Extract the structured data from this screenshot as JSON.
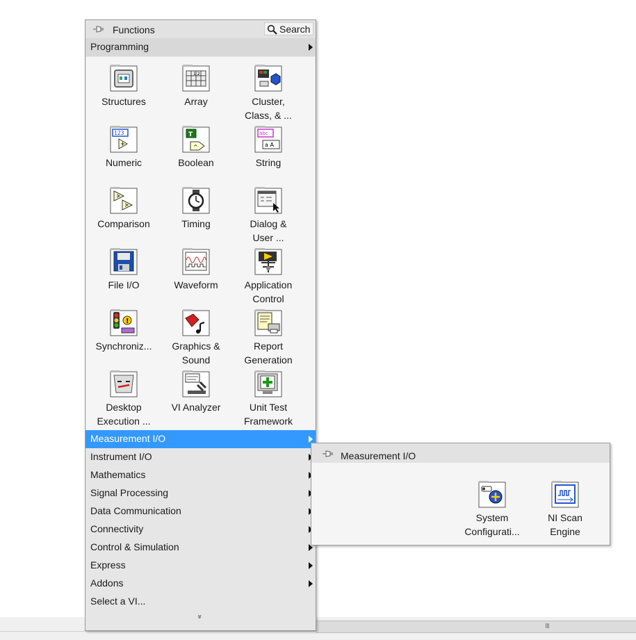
{
  "palette": {
    "title": "Functions",
    "search_label": "Search",
    "current_category": "Programming",
    "grid_items": [
      {
        "line1": "Structures",
        "line2": ""
      },
      {
        "line1": "Array",
        "line2": ""
      },
      {
        "line1": "Cluster,",
        "line2": "Class, & ..."
      },
      {
        "line1": "Numeric",
        "line2": ""
      },
      {
        "line1": "Boolean",
        "line2": ""
      },
      {
        "line1": "String",
        "line2": ""
      },
      {
        "line1": "Comparison",
        "line2": ""
      },
      {
        "line1": "Timing",
        "line2": ""
      },
      {
        "line1": "Dialog &",
        "line2": "User ..."
      },
      {
        "line1": "File I/O",
        "line2": ""
      },
      {
        "line1": "Waveform",
        "line2": ""
      },
      {
        "line1": "Application",
        "line2": "Control"
      },
      {
        "line1": "Synchroniz...",
        "line2": ""
      },
      {
        "line1": "Graphics &",
        "line2": "Sound"
      },
      {
        "line1": "Report",
        "line2": "Generation"
      },
      {
        "line1": "Desktop",
        "line2": "Execution ..."
      },
      {
        "line1": "VI Analyzer",
        "line2": ""
      },
      {
        "line1": "Unit Test",
        "line2": "Framework"
      }
    ],
    "categories": [
      {
        "label": "Measurement I/O",
        "selected": true
      },
      {
        "label": "Instrument I/O"
      },
      {
        "label": "Mathematics"
      },
      {
        "label": "Signal Processing"
      },
      {
        "label": "Data Communication"
      },
      {
        "label": "Connectivity"
      },
      {
        "label": "Control & Simulation"
      },
      {
        "label": "Express"
      },
      {
        "label": "Addons"
      },
      {
        "label": "Select a VI..."
      }
    ],
    "more_glyph": "»"
  },
  "submenu": {
    "title": "Measurement I/O",
    "items": [
      {
        "line1": "System",
        "line2": "Configurati..."
      },
      {
        "line1": "NI Scan",
        "line2": "Engine"
      }
    ]
  },
  "scrollbar": {
    "grip": "III"
  },
  "colors": {
    "selection": "#3399ff",
    "panel": "#e6e6e6",
    "grid": "#f5f5f5"
  }
}
